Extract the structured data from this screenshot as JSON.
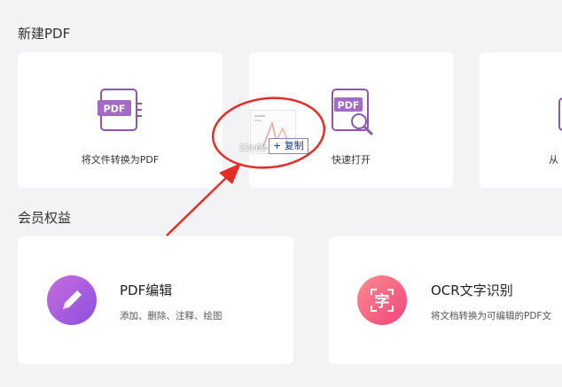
{
  "sections": {
    "new_pdf_title": "新建PDF",
    "member_title": "会员权益"
  },
  "cards": {
    "convert_label": "将文件转换为PDF",
    "quick_open_label": "快速打开",
    "third_label_partial": "从"
  },
  "benefits": {
    "pdf_edit": {
      "title": "PDF编辑",
      "subtitle": "添加、删除、注释、绘图"
    },
    "ocr": {
      "title": "OCR文字识别",
      "subtitle": "将文档转换为可编辑的PDF文"
    }
  },
  "drag": {
    "file_name": "22c6b",
    "copy_tip": "+ 复制"
  },
  "icons": {
    "pdf_badge_text": "PDF",
    "ocr_char": "字"
  },
  "colors": {
    "accent_purple": "#8f55b3",
    "edit_gradient_start": "#c76ddc",
    "edit_gradient_end": "#8b4fe0",
    "ocr_gradient_start": "#ff8a8f",
    "ocr_gradient_end": "#f0457a",
    "annotation_red": "#e52d27"
  }
}
